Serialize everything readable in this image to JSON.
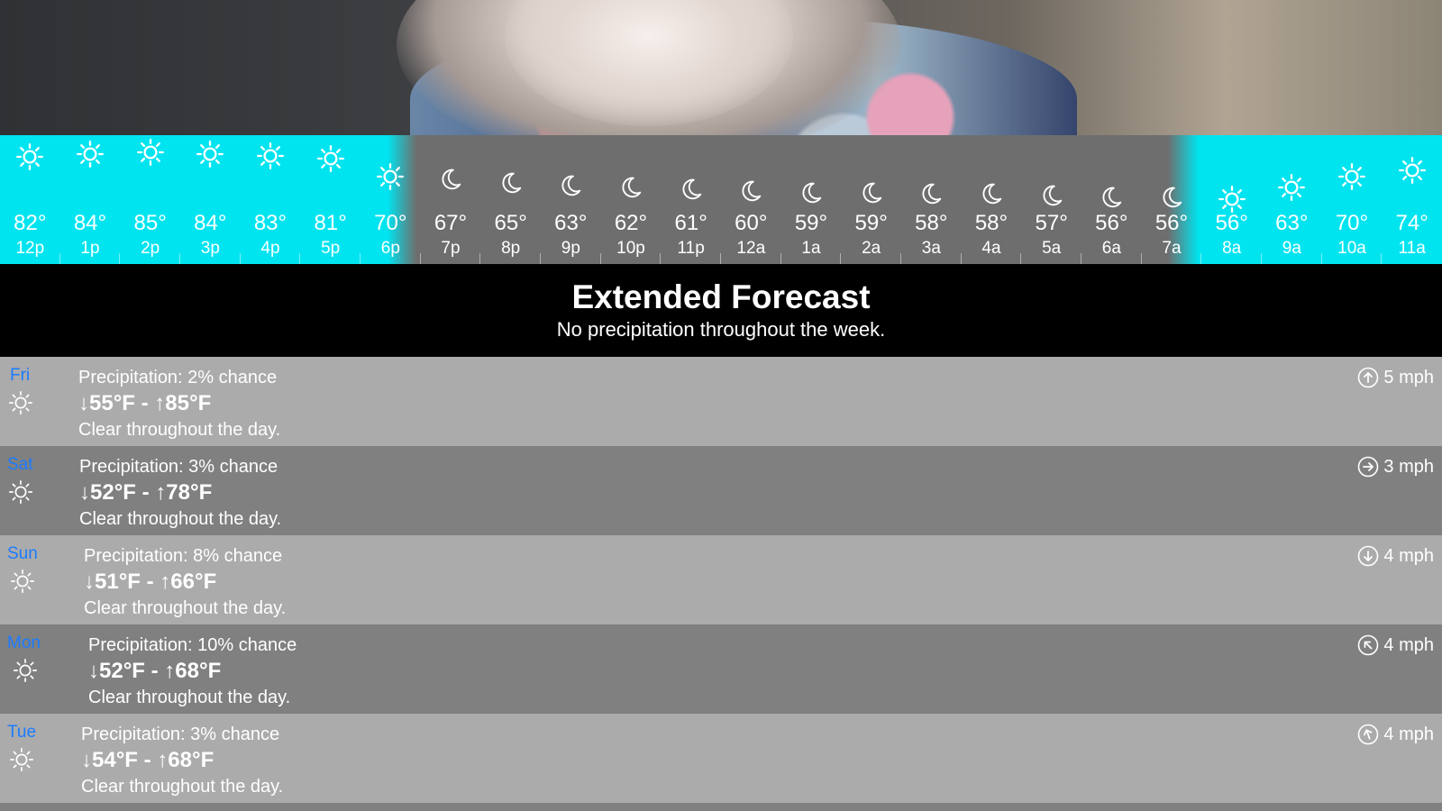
{
  "hourly": [
    {
      "temp": "82°",
      "time": "12p",
      "icon": "sun-icon"
    },
    {
      "temp": "84°",
      "time": "1p",
      "icon": "sun-icon"
    },
    {
      "temp": "85°",
      "time": "2p",
      "icon": "sun-icon"
    },
    {
      "temp": "84°",
      "time": "3p",
      "icon": "sun-icon"
    },
    {
      "temp": "83°",
      "time": "4p",
      "icon": "sun-icon"
    },
    {
      "temp": "81°",
      "time": "5p",
      "icon": "sun-icon"
    },
    {
      "temp": "70°",
      "time": "6p",
      "icon": "sun-icon"
    },
    {
      "temp": "67°",
      "time": "7p",
      "icon": "moon-icon"
    },
    {
      "temp": "65°",
      "time": "8p",
      "icon": "moon-icon"
    },
    {
      "temp": "63°",
      "time": "9p",
      "icon": "moon-icon"
    },
    {
      "temp": "62°",
      "time": "10p",
      "icon": "moon-icon"
    },
    {
      "temp": "61°",
      "time": "11p",
      "icon": "moon-icon"
    },
    {
      "temp": "60°",
      "time": "12a",
      "icon": "moon-icon"
    },
    {
      "temp": "59°",
      "time": "1a",
      "icon": "moon-icon"
    },
    {
      "temp": "59°",
      "time": "2a",
      "icon": "moon-icon"
    },
    {
      "temp": "58°",
      "time": "3a",
      "icon": "moon-icon"
    },
    {
      "temp": "58°",
      "time": "4a",
      "icon": "moon-icon"
    },
    {
      "temp": "57°",
      "time": "5a",
      "icon": "moon-icon"
    },
    {
      "temp": "56°",
      "time": "6a",
      "icon": "moon-icon"
    },
    {
      "temp": "56°",
      "time": "7a",
      "icon": "moon-icon"
    },
    {
      "temp": "56°",
      "time": "8a",
      "icon": "sun-icon"
    },
    {
      "temp": "63°",
      "time": "9a",
      "icon": "sun-icon"
    },
    {
      "temp": "70°",
      "time": "10a",
      "icon": "sun-icon"
    },
    {
      "temp": "74°",
      "time": "11a",
      "icon": "sun-icon"
    }
  ],
  "extended": {
    "title": "Extended Forecast",
    "subtitle": "No precipitation throughout the week."
  },
  "days": [
    {
      "name": "Fri",
      "precip": "Precipitation: 2% chance",
      "range": "↓55°F - ↑85°F",
      "summary": "Clear throughout the day.",
      "wind": "5 mph",
      "wind_icon": "arrow-up-circle-icon",
      "wind_direction_deg": 0
    },
    {
      "name": "Sat",
      "precip": "Precipitation: 3% chance",
      "range": "↓52°F - ↑78°F",
      "summary": "Clear throughout the day.",
      "wind": "3 mph",
      "wind_icon": "arrow-right-circle-icon",
      "wind_direction_deg": 90
    },
    {
      "name": "Sun",
      "precip": "Precipitation: 8% chance",
      "range": "↓51°F - ↑66°F",
      "summary": "Clear throughout the day.",
      "wind": "4 mph",
      "wind_icon": "arrow-down-circle-icon",
      "wind_direction_deg": 180
    },
    {
      "name": "Mon",
      "precip": "Precipitation: 10% chance",
      "range": "↓52°F - ↑68°F",
      "summary": "Clear throughout the day.",
      "wind": "4 mph",
      "wind_icon": "arrow-up-left-circle-icon",
      "wind_direction_deg": 315
    },
    {
      "name": "Tue",
      "precip": "Precipitation: 3% chance",
      "range": "↓54°F - ↑68°F",
      "summary": "Clear throughout the day.",
      "wind": "4 mph",
      "wind_icon": "arrow-up-left-circle-icon",
      "wind_direction_deg": 340
    }
  ],
  "colors": {
    "daylight": "#00e4f0",
    "night": "#6e6e6e",
    "day_name": "#1a7cff",
    "row_light": "#ababab",
    "row_dark": "#808080"
  }
}
